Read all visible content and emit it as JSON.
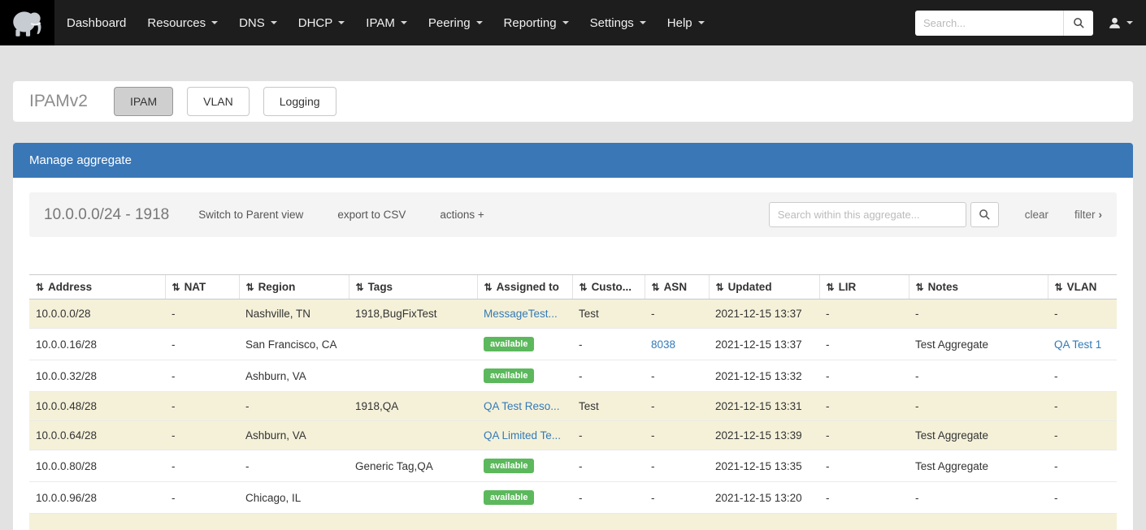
{
  "icons": {
    "sort": "⇅",
    "chevron_right": "›"
  },
  "navbar": {
    "items": [
      {
        "label": "Dashboard",
        "dropdown": false
      },
      {
        "label": "Resources",
        "dropdown": true
      },
      {
        "label": "DNS",
        "dropdown": true
      },
      {
        "label": "DHCP",
        "dropdown": true
      },
      {
        "label": "IPAM",
        "dropdown": true
      },
      {
        "label": "Peering",
        "dropdown": true
      },
      {
        "label": "Reporting",
        "dropdown": true
      },
      {
        "label": "Settings",
        "dropdown": true
      },
      {
        "label": "Help",
        "dropdown": true
      }
    ],
    "search_placeholder": "Search..."
  },
  "page": {
    "title": "IPAMv2",
    "tabs": [
      {
        "label": "IPAM",
        "active": true
      },
      {
        "label": "VLAN",
        "active": false
      },
      {
        "label": "Logging",
        "active": false
      }
    ]
  },
  "panel": {
    "title": "Manage aggregate",
    "toolbar": {
      "aggregate_label": "10.0.0.0/24 - 1918",
      "switch_parent": "Switch to Parent view",
      "export_csv": "export to CSV",
      "actions": "actions +",
      "search_placeholder": "Search within this aggregate...",
      "clear": "clear",
      "filter": "filter"
    },
    "table": {
      "columns": [
        {
          "key": "address",
          "label": "Address"
        },
        {
          "key": "nat",
          "label": "NAT"
        },
        {
          "key": "region",
          "label": "Region"
        },
        {
          "key": "tags",
          "label": "Tags"
        },
        {
          "key": "assigned",
          "label": "Assigned to"
        },
        {
          "key": "customer",
          "label": "Custo..."
        },
        {
          "key": "asn",
          "label": "ASN"
        },
        {
          "key": "updated",
          "label": "Updated"
        },
        {
          "key": "lir",
          "label": "LIR"
        },
        {
          "key": "notes",
          "label": "Notes"
        },
        {
          "key": "vlan",
          "label": "VLAN"
        }
      ],
      "rows": [
        {
          "highlight": true,
          "cells": [
            {
              "text": "10.0.0.0/28"
            },
            {
              "text": "-"
            },
            {
              "text": "Nashville, TN"
            },
            {
              "text": "1918,BugFixTest"
            },
            {
              "text": "MessageTest...",
              "type": "link"
            },
            {
              "text": "Test"
            },
            {
              "text": "-"
            },
            {
              "text": "2021-12-15 13:37"
            },
            {
              "text": "-"
            },
            {
              "text": "-"
            },
            {
              "text": "-"
            }
          ]
        },
        {
          "highlight": false,
          "cells": [
            {
              "text": "10.0.0.16/28"
            },
            {
              "text": "-"
            },
            {
              "text": "San Francisco, CA"
            },
            {
              "text": ""
            },
            {
              "text": "available",
              "type": "badge"
            },
            {
              "text": "-"
            },
            {
              "text": "8038",
              "type": "link"
            },
            {
              "text": "2021-12-15 13:37"
            },
            {
              "text": "-"
            },
            {
              "text": "Test Aggregate"
            },
            {
              "text": "QA Test 1",
              "type": "link"
            }
          ]
        },
        {
          "highlight": false,
          "cells": [
            {
              "text": "10.0.0.32/28"
            },
            {
              "text": "-"
            },
            {
              "text": "Ashburn, VA"
            },
            {
              "text": ""
            },
            {
              "text": "available",
              "type": "badge"
            },
            {
              "text": "-"
            },
            {
              "text": "-"
            },
            {
              "text": "2021-12-15 13:32"
            },
            {
              "text": "-"
            },
            {
              "text": "-"
            },
            {
              "text": "-"
            }
          ]
        },
        {
          "highlight": true,
          "cells": [
            {
              "text": "10.0.0.48/28"
            },
            {
              "text": "-"
            },
            {
              "text": "-"
            },
            {
              "text": "1918,QA"
            },
            {
              "text": "QA Test Reso...",
              "type": "link"
            },
            {
              "text": "Test"
            },
            {
              "text": "-"
            },
            {
              "text": "2021-12-15 13:31"
            },
            {
              "text": "-"
            },
            {
              "text": "-"
            },
            {
              "text": "-"
            }
          ]
        },
        {
          "highlight": true,
          "cells": [
            {
              "text": "10.0.0.64/28"
            },
            {
              "text": "-"
            },
            {
              "text": "Ashburn, VA"
            },
            {
              "text": ""
            },
            {
              "text": "QA Limited Te...",
              "type": "link"
            },
            {
              "text": "-"
            },
            {
              "text": "-"
            },
            {
              "text": "2021-12-15 13:39"
            },
            {
              "text": "-"
            },
            {
              "text": "Test Aggregate"
            },
            {
              "text": "-"
            }
          ]
        },
        {
          "highlight": false,
          "cells": [
            {
              "text": "10.0.0.80/28"
            },
            {
              "text": "-"
            },
            {
              "text": "-"
            },
            {
              "text": "Generic Tag,QA"
            },
            {
              "text": "available",
              "type": "badge"
            },
            {
              "text": "-"
            },
            {
              "text": "-"
            },
            {
              "text": "2021-12-15 13:35"
            },
            {
              "text": "-"
            },
            {
              "text": "Test Aggregate"
            },
            {
              "text": "-"
            }
          ]
        },
        {
          "highlight": false,
          "cells": [
            {
              "text": "10.0.0.96/28"
            },
            {
              "text": "-"
            },
            {
              "text": "Chicago, IL"
            },
            {
              "text": ""
            },
            {
              "text": "available",
              "type": "badge"
            },
            {
              "text": "-"
            },
            {
              "text": "-"
            },
            {
              "text": "2021-12-15 13:20"
            },
            {
              "text": "-"
            },
            {
              "text": "-"
            },
            {
              "text": "-"
            }
          ]
        }
      ]
    }
  },
  "colors": {
    "navbar_bg": "#1d1d1d",
    "panel_header_bg": "#3a77b7",
    "highlight_row_bg": "#f5f1d9",
    "badge_bg": "#5cb85c",
    "link_color": "#337ab7"
  }
}
